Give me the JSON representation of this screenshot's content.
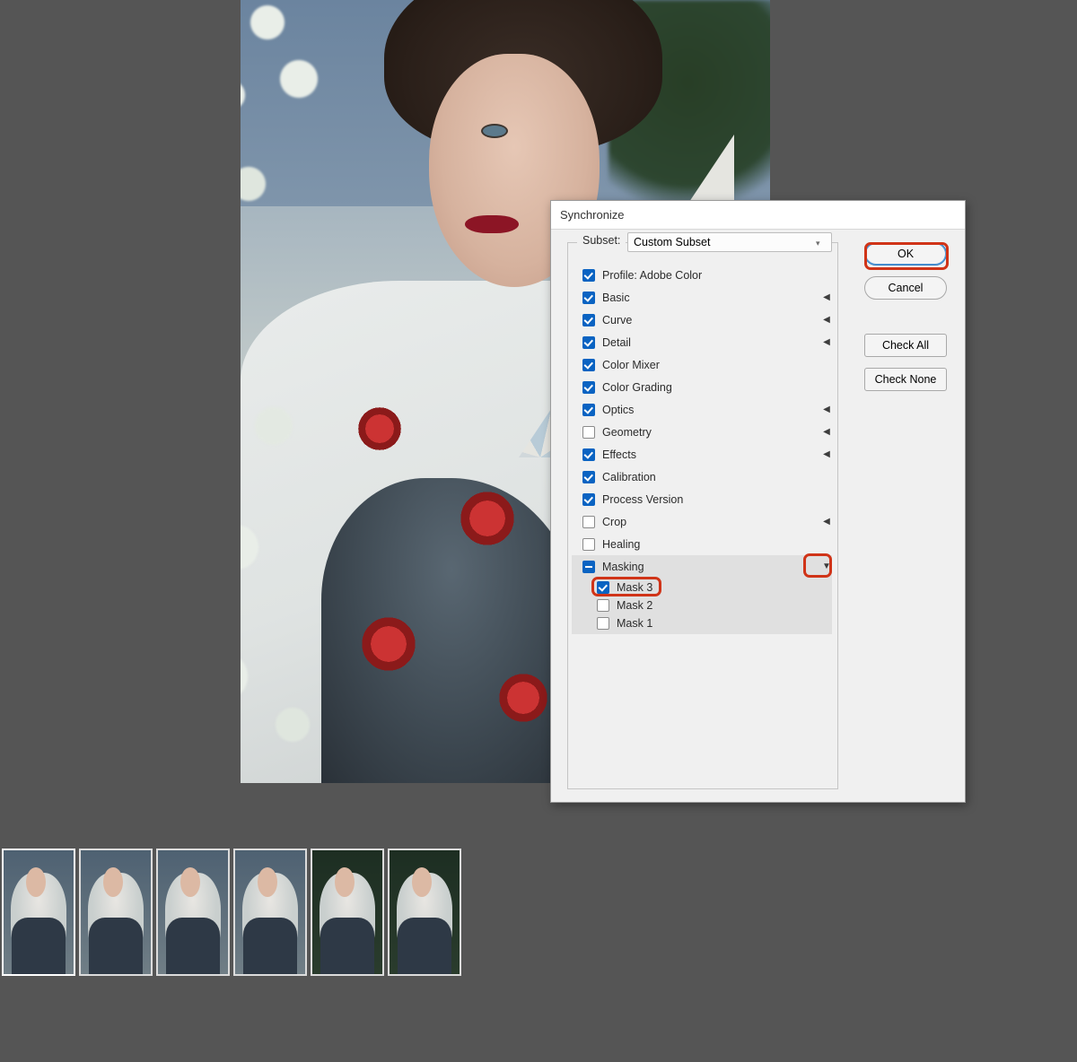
{
  "dialog": {
    "title": "Synchronize",
    "subset_label": "Subset:",
    "subset_value": "Custom Subset",
    "buttons": {
      "ok": "OK",
      "cancel": "Cancel",
      "check_all": "Check All",
      "check_none": "Check None"
    },
    "options": [
      {
        "label": "Profile: Adobe Color",
        "checked": true,
        "arrow": false
      },
      {
        "label": "Basic",
        "checked": true,
        "arrow": true
      },
      {
        "label": "Curve",
        "checked": true,
        "arrow": true
      },
      {
        "label": "Detail",
        "checked": true,
        "arrow": true
      },
      {
        "label": "Color Mixer",
        "checked": true,
        "arrow": false
      },
      {
        "label": "Color Grading",
        "checked": true,
        "arrow": false
      },
      {
        "label": "Optics",
        "checked": true,
        "arrow": true
      },
      {
        "label": "Geometry",
        "checked": false,
        "arrow": true
      },
      {
        "label": "Effects",
        "checked": true,
        "arrow": true
      },
      {
        "label": "Calibration",
        "checked": true,
        "arrow": false
      },
      {
        "label": "Process Version",
        "checked": true,
        "arrow": false
      },
      {
        "label": "Crop",
        "checked": false,
        "arrow": true
      },
      {
        "label": "Healing",
        "checked": false,
        "arrow": false
      }
    ],
    "masking": {
      "label": "Masking",
      "state": "mixed",
      "expanded": true,
      "children": [
        {
          "label": "Mask 3",
          "checked": true
        },
        {
          "label": "Mask 2",
          "checked": false
        },
        {
          "label": "Mask 1",
          "checked": false
        }
      ]
    }
  },
  "filmstrip": {
    "count": 6,
    "selected_index": 0
  }
}
